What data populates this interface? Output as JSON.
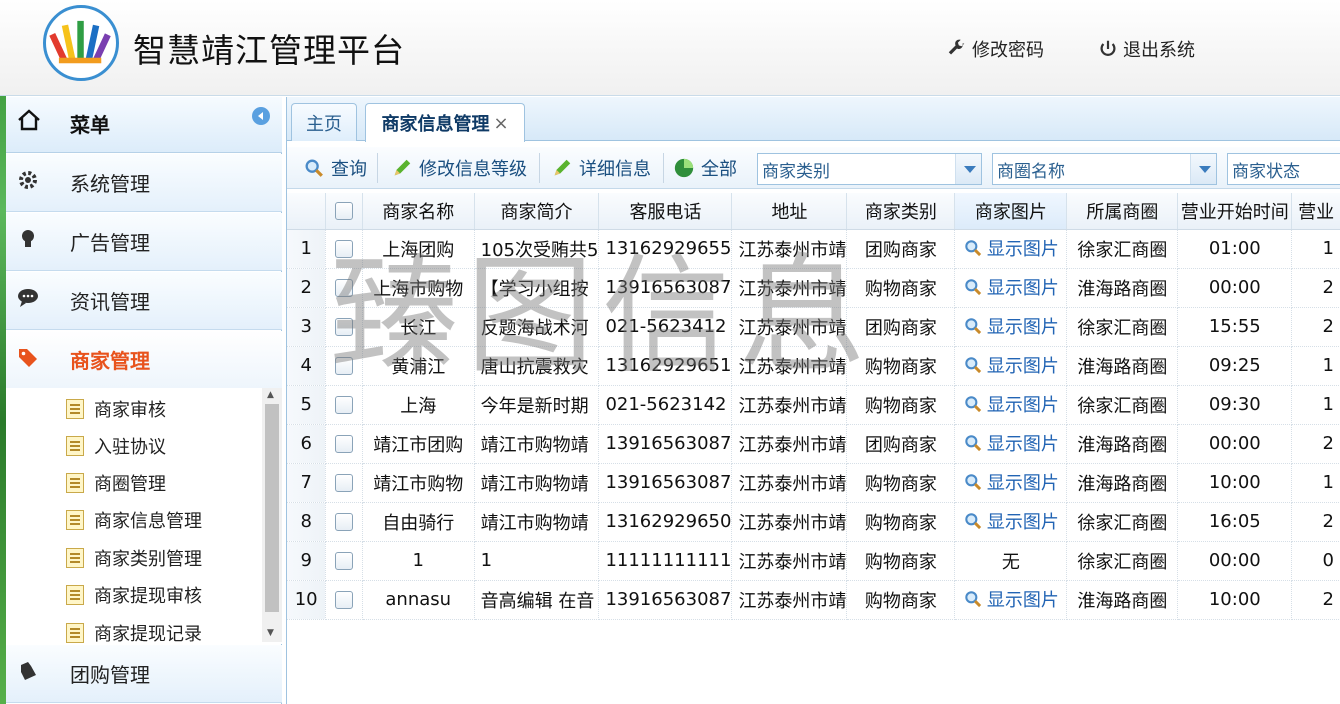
{
  "header": {
    "title": "智慧靖江管理平台",
    "change_password": "修改密码",
    "logout": "退出系统"
  },
  "sidebar": {
    "menu_title": "菜单",
    "items": [
      {
        "label": "系统管理",
        "icon": "gear-icon"
      },
      {
        "label": "广告管理",
        "icon": "bulb-icon"
      },
      {
        "label": "资讯管理",
        "icon": "chat-icon"
      },
      {
        "label": "商家管理",
        "icon": "tag-icon"
      },
      {
        "label": "团购管理",
        "icon": "bell-icon"
      }
    ],
    "subitems": [
      "商家审核",
      "入驻协议",
      "商圈管理",
      "商家信息管理",
      "商家类别管理",
      "商家提现审核",
      "商家提现记录"
    ]
  },
  "tabs": [
    {
      "label": "主页"
    },
    {
      "label": "商家信息管理",
      "close": "×"
    }
  ],
  "toolbar": {
    "query": "查询",
    "edit_level": "修改信息等级",
    "detail": "详细信息",
    "all": "全部",
    "category_placeholder": "商家类别",
    "district_placeholder": "商圈名称",
    "status_placeholder": "商家状态"
  },
  "table": {
    "columns": [
      "商家名称",
      "商家简介",
      "客服电话",
      "地址",
      "商家类别",
      "商家图片",
      "所属商圈",
      "营业开始时间",
      "营业"
    ],
    "rows": [
      {
        "n": "1",
        "name": "上海团购",
        "intro": "105次受贿共5",
        "phone": "13162929655",
        "addr": "江苏泰州市靖",
        "cat": "团购商家",
        "img": "显示图片",
        "district": "徐家汇商圈",
        "open": "01:00",
        "more": "1"
      },
      {
        "n": "2",
        "name": "上海市购物",
        "intro": "【学习小组按",
        "phone": "13916563087",
        "addr": "江苏泰州市靖",
        "cat": "购物商家",
        "img": "显示图片",
        "district": "淮海路商圈",
        "open": "00:00",
        "more": "2"
      },
      {
        "n": "3",
        "name": "长江",
        "intro": "反题海战术河",
        "phone": "021-5623412",
        "addr": "江苏泰州市靖",
        "cat": "团购商家",
        "img": "显示图片",
        "district": "徐家汇商圈",
        "open": "15:55",
        "more": "2"
      },
      {
        "n": "4",
        "name": "黄浦江",
        "intro": "唐山抗震救灾",
        "phone": "13162929651",
        "addr": "江苏泰州市靖",
        "cat": "购物商家",
        "img": "显示图片",
        "district": "淮海路商圈",
        "open": "09:25",
        "more": "1"
      },
      {
        "n": "5",
        "name": "上海",
        "intro": "今年是新时期",
        "phone": "021-5623142",
        "addr": "江苏泰州市靖",
        "cat": "购物商家",
        "img": "显示图片",
        "district": "徐家汇商圈",
        "open": "09:30",
        "more": "1"
      },
      {
        "n": "6",
        "name": "靖江市团购",
        "intro": "靖江市购物靖",
        "phone": "13916563087",
        "addr": "江苏泰州市靖",
        "cat": "团购商家",
        "img": "显示图片",
        "district": "淮海路商圈",
        "open": "00:00",
        "more": "2"
      },
      {
        "n": "7",
        "name": "靖江市购物",
        "intro": "靖江市购物靖",
        "phone": "13916563087",
        "addr": "江苏泰州市靖",
        "cat": "购物商家",
        "img": "显示图片",
        "district": "淮海路商圈",
        "open": "10:00",
        "more": "1"
      },
      {
        "n": "8",
        "name": "自由骑行",
        "intro": "靖江市购物靖",
        "phone": "13162929650",
        "addr": "江苏泰州市靖",
        "cat": "购物商家",
        "img": "显示图片",
        "district": "徐家汇商圈",
        "open": "16:05",
        "more": "2"
      },
      {
        "n": "9",
        "name": "1",
        "intro": "1",
        "phone": "11111111111",
        "addr": "江苏泰州市靖",
        "cat": "购物商家",
        "img": "无",
        "district": "徐家汇商圈",
        "open": "00:00",
        "more": "0"
      },
      {
        "n": "10",
        "name": "annasu",
        "intro": "音高编辑 在音",
        "phone": "13916563087",
        "addr": "江苏泰州市靖",
        "cat": "购物商家",
        "img": "显示图片",
        "district": "淮海路商圈",
        "open": "10:00",
        "more": "2"
      }
    ]
  },
  "watermark": "臻图信息",
  "colors": {
    "accent": "#e8531d",
    "link": "#2264b4",
    "border": "#9fc3e0"
  }
}
